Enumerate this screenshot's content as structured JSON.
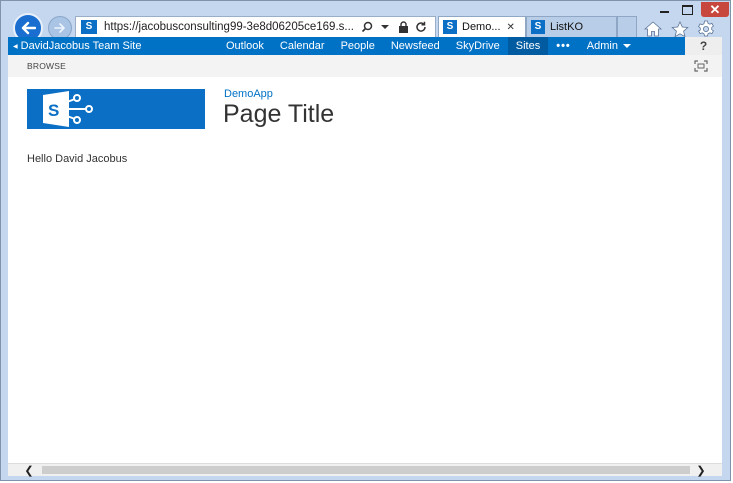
{
  "browser": {
    "address_url": "https://jacobusconsulting99-3e8d06205ce169.s...",
    "tabs": [
      {
        "label": "Demo...",
        "close": "✕"
      },
      {
        "label": "ListKO"
      }
    ]
  },
  "suitebar": {
    "site_name": "DavidJacobus Team Site",
    "nav_items": [
      "Outlook",
      "Calendar",
      "People",
      "Newsfeed",
      "SkyDrive",
      "Sites"
    ],
    "active_item": "Sites",
    "more": "•••",
    "admin": "Admin",
    "help": "?"
  },
  "ribbon": {
    "browse_tab": "BROWSE"
  },
  "page": {
    "breadcrumb": "DemoApp",
    "title": "Page Title",
    "greeting": "Hello David Jacobus"
  },
  "colors": {
    "sharepoint_blue": "#0072c6",
    "frame": "#c4d7ee",
    "close_button": "#c7463d"
  }
}
